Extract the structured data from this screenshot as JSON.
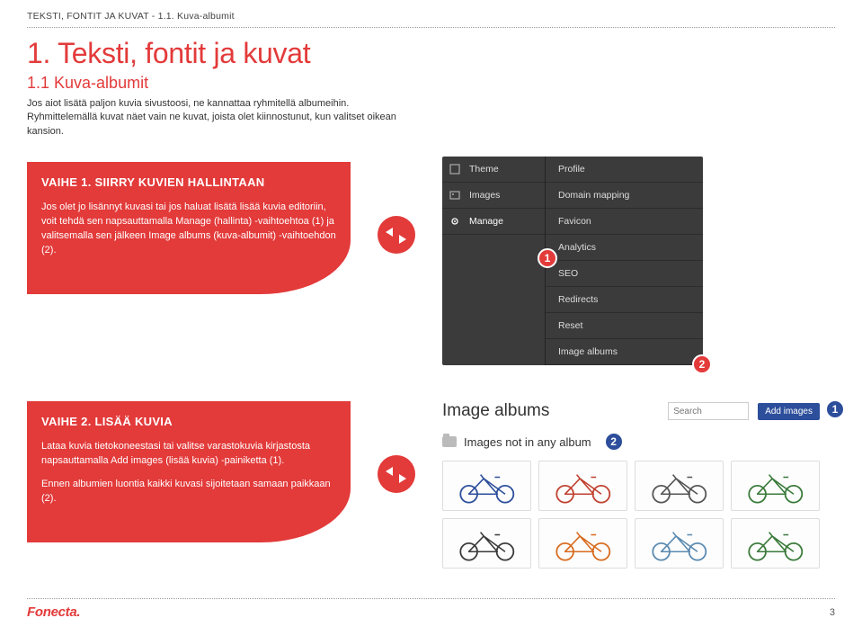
{
  "breadcrumb": "TEKSTI, FONTIT JA KUVAT  -  1.1. Kuva-albumit",
  "main_title": "1. Teksti, fontit ja kuvat",
  "sub_title": "1.1 Kuva-albumit",
  "intro_line1": "Jos aiot lisätä paljon kuvia sivustoosi, ne kannattaa ryhmitellä albumeihin.",
  "intro_line2": "Ryhmittelemällä kuvat näet vain ne kuvat, joista olet kiinnostunut, kun valitset oikean kansion.",
  "step1": {
    "title": "VAIHE 1. SIIRRY KUVIEN HALLINTAAN",
    "p1": "Jos olet jo lisännyt kuvasi tai jos haluat lisätä lisää kuvia editoriin, voit tehdä sen napsauttamalla Manage (hallinta) -vaihtoehtoa (1) ja valitsemalla sen jälkeen Image albums (kuva-albumit) -vaihtoehdon (2)."
  },
  "step2": {
    "title": "VAIHE 2. LISÄÄ KUVIA",
    "p1": "Lataa kuvia tietokoneestasi tai valitse varastokuvia kirjastosta napsauttamalla Add images (lisää kuvia) -painiketta (1).",
    "p2": "Ennen albumien luontia kaikki kuvasi sijoitetaan samaan paikkaan (2)."
  },
  "menu": {
    "left": [
      "Theme",
      "Images",
      "Manage"
    ],
    "right": [
      "Profile",
      "Domain mapping",
      "Favicon",
      "Analytics",
      "SEO",
      "Redirects",
      "Reset",
      "Image albums"
    ]
  },
  "markers": {
    "one": "1",
    "two": "2"
  },
  "shot2": {
    "title": "Image albums",
    "search_placeholder": "Search",
    "add_button": "Add images",
    "subtitle": "Images not in any album"
  },
  "brand": "Fonecta",
  "page_number": "3",
  "bike_colors": [
    "#2c4e9b",
    "#c04030",
    "#555555",
    "#3a7a3a",
    "#3a3a3a",
    "#d86b1f",
    "#5a8ab0",
    "#3a7a3a"
  ]
}
